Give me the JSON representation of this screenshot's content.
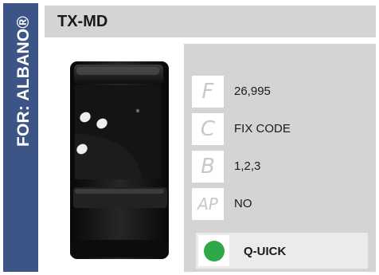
{
  "side_label": "FOR: ALBANO®",
  "title": "TX-MD",
  "specs": [
    {
      "code": "F",
      "value": "26,995"
    },
    {
      "code": "C",
      "value": "FIX CODE"
    },
    {
      "code": "B",
      "value": "1,2,3"
    },
    {
      "code": "AP",
      "value": "NO"
    }
  ],
  "status": {
    "label": "Q-UICK",
    "color": "#2fa84a"
  },
  "colors": {
    "band": "#3d5487",
    "panel": "#d4d4d4"
  }
}
